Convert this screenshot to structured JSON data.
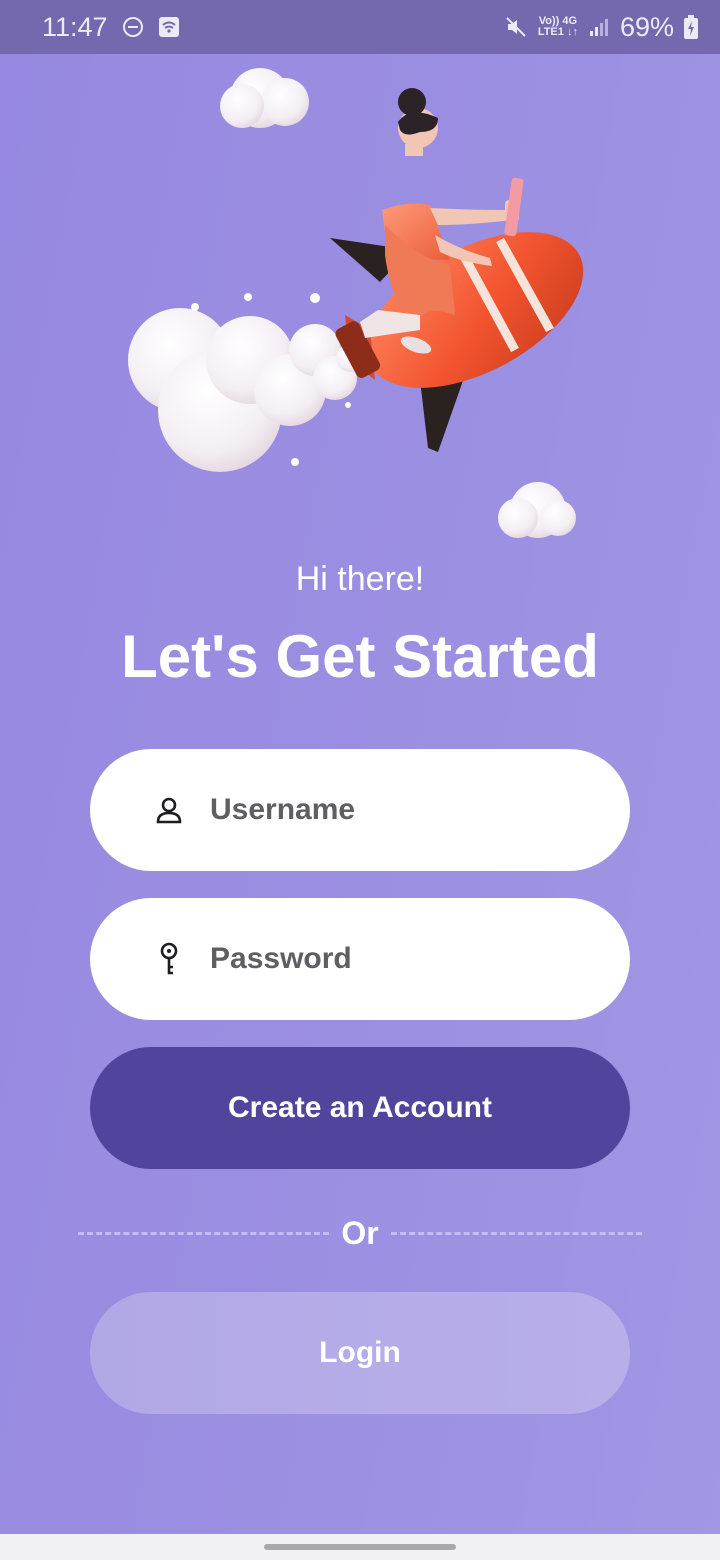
{
  "status_bar": {
    "time": "11:47",
    "network_top": "Vo)) 4G",
    "network_bottom": "LTE1 ↓↑",
    "battery": "69%",
    "icons": [
      "do-not-disturb-icon",
      "wifi-icon",
      "mute-icon",
      "signal-icon",
      "battery-icon"
    ]
  },
  "illustration": {
    "subject": "person-riding-rocket-illustration"
  },
  "greeting": "Hi there!",
  "title": "Let's Get Started",
  "form": {
    "username_placeholder": "Username",
    "password_placeholder": "Password",
    "username_icon": "person-icon",
    "password_icon": "key-icon"
  },
  "buttons": {
    "create_account": "Create an Account",
    "divider": "Or",
    "login": "Login"
  },
  "colors": {
    "background": "#9a8ee1",
    "primary_button": "#50449c",
    "secondary_button": "#b5ace8",
    "text_light": "#ffffff"
  }
}
